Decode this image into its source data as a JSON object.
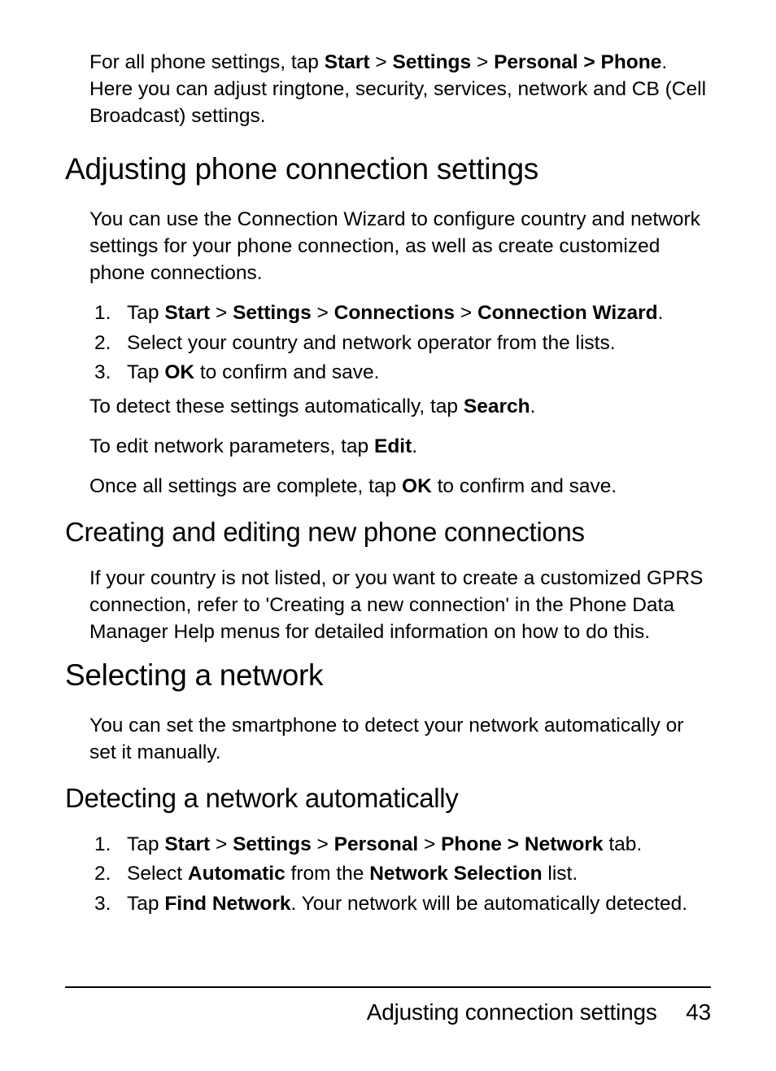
{
  "intro": {
    "prefix": "For all phone settings, tap ",
    "bold1": "Start",
    "gt1": " > ",
    "bold2": "Settings",
    "gt2": " > ",
    "bold3": "Personal > Phone",
    "suffix": ". Here you can adjust ringtone, security, services, network and CB (Cell Broadcast) settings."
  },
  "h1_1": "Adjusting phone connection settings",
  "p1": "You can use the Connection Wizard to configure country and network settings for your phone connection, as well as create customized phone connections.",
  "steps1": {
    "n1": "1.",
    "s1a": "Tap ",
    "s1b1": "Start",
    "s1gt1": " > ",
    "s1b2": "Settings",
    "s1gt2": " > ",
    "s1b3": "Connections",
    "s1gt3": " > ",
    "s1b4": "Connection Wizard",
    "s1end": ".",
    "n2": "2.",
    "s2": "Select your country and network operator from the lists.",
    "n3": "3.",
    "s3a": "Tap ",
    "s3b": "OK",
    "s3c": " to confirm and save."
  },
  "afterlist1a": "To detect these settings automatically, tap ",
  "afterlist1b": "Search",
  "afterlist1c": ".",
  "p2a": "To edit network parameters, tap ",
  "p2b": "Edit",
  "p2c": ".",
  "p3a": "Once all settings are complete, tap ",
  "p3b": "OK",
  "p3c": " to confirm and save.",
  "h2_1": "Creating and editing new phone connections",
  "p4": "If your country is not listed, or you want to create a customized GPRS connection, refer to 'Creating a new connection' in the Phone Data Manager Help menus for detailed information on how to do this.",
  "h1_2": "Selecting a network",
  "p5": "You can set the smartphone to detect your network automatically or set it manually.",
  "h2_2": "Detecting a network automatically",
  "steps2": {
    "n1": "1.",
    "s1a": "Tap ",
    "s1b1": "Start",
    "s1gt1": " > ",
    "s1b2": "Settings",
    "s1gt2": " > ",
    "s1b3": "Personal",
    "s1gt3": " > ",
    "s1b4": "Phone > Network",
    "s1end": " tab.",
    "n2": "2.",
    "s2a": "Select ",
    "s2b1": "Automatic",
    "s2mid": " from the ",
    "s2b2": "Network Selection",
    "s2end": " list.",
    "n3": "3.",
    "s3a": "Tap ",
    "s3b": "Find Network",
    "s3c": ". Your network will be automatically detected."
  },
  "footer": {
    "title": "Adjusting connection settings",
    "page": "43"
  }
}
